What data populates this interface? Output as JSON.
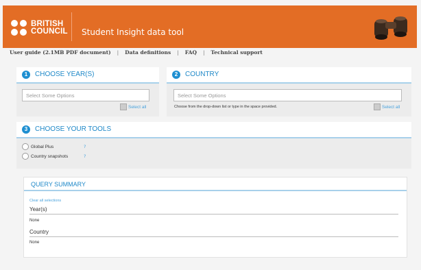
{
  "header": {
    "logo_line1": "BRITISH",
    "logo_line2": "COUNCIL",
    "app_title": "Student Insight data tool",
    "background": "#e36d25",
    "illustration": "binoculars-icon"
  },
  "nav": {
    "items": [
      "User guide (2.1MB PDF document)",
      "Data definitions",
      "FAQ",
      "Technical support"
    ],
    "separator": "|"
  },
  "sections": {
    "year": {
      "number": "1",
      "title": "CHOOSE YEAR(S)",
      "placeholder": "Select Some Options",
      "select_all": "Select all"
    },
    "country": {
      "number": "2",
      "title": "COUNTRY",
      "placeholder": "Select Some Options",
      "hint": "Choose from the drop-down list or type in the space provided.",
      "select_all": "Select all"
    },
    "tools": {
      "number": "3",
      "title": "CHOOSE YOUR TOOLS",
      "options": [
        {
          "label": "Global Plus",
          "help": "?"
        },
        {
          "label": "Country snapshots",
          "help": "?"
        }
      ]
    }
  },
  "summary": {
    "title": "QUERY SUMMARY",
    "clear_label": "Clear all selections",
    "fields": [
      {
        "label": "Year(s)",
        "value": "None"
      },
      {
        "label": "Country",
        "value": "None"
      }
    ]
  },
  "colors": {
    "accent": "#1e88c8",
    "header_bg": "#e36d25",
    "section_rule": "#a7d0ea"
  }
}
